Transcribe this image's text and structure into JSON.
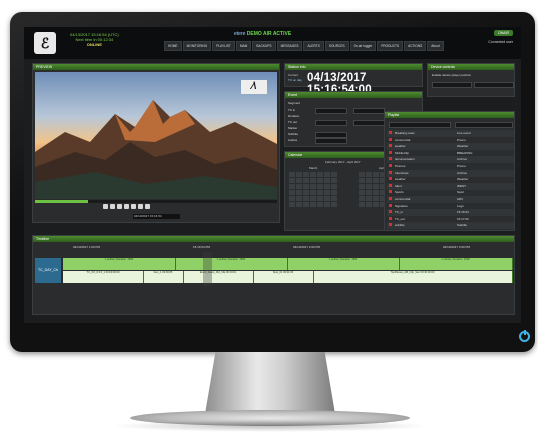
{
  "screen": {
    "header": {
      "clock_line1": "04/13/2017 15:16:54 (UTC)",
      "clock_line2": "Next item in 00:12:34",
      "clock_line3": "ONLINE",
      "app_title_prefix": "etere",
      "app_title_main": "DEMO AIR ACTIVE",
      "status_button": "ONAIR",
      "user": "Connected user"
    },
    "nav": [
      "HOME",
      "MONITORING",
      "PLAYLIST",
      "MAM",
      "BACKUPS",
      "MESSAGES",
      "ALERTS",
      "SOURCES",
      "On-air logger",
      "PRODUCTS",
      "ACTIONS",
      "About"
    ],
    "player": {
      "title": "PREVIEW",
      "timecode_box": "04/13/2017 15:16:54"
    },
    "clock_panel": {
      "title": "Station info",
      "label": "Current",
      "small": "TC on day",
      "timecode": "04/13/2017 15:16:54:00"
    },
    "props": {
      "title": "Event",
      "fields": [
        "Segment",
        "TC in",
        "Duration",
        "TC out",
        "Marker",
        "Subtitle",
        "Audios"
      ]
    },
    "calendar": {
      "title": "Calendar",
      "range": "February 2017 - April 2017",
      "month1": "March",
      "month2": "April"
    },
    "right_panel": {
      "title": "Device controls",
      "line": "Enable device player position"
    },
    "list": {
      "title": "Playlist",
      "rows": [
        [
          "Breaking news",
          "Live event"
        ],
        [
          "commercial",
          "Promo"
        ],
        [
          "weather",
          "Weather"
        ],
        [
          "MobileClip",
          "BREAKING"
        ],
        [
          "documentation",
          "Archive"
        ],
        [
          "Promos",
          "Promo"
        ],
        [
          "Interviews",
          "Archive"
        ],
        [
          "weather",
          "Weather"
        ],
        [
          "Ident",
          "IDENT"
        ],
        [
          "Sports",
          "Sport"
        ],
        [
          "commercial",
          "ADV"
        ],
        [
          "Signature",
          "Logo"
        ],
        [
          "TC_in",
          "15:16:54"
        ],
        [
          "TC_out",
          "15:17:00"
        ],
        [
          "subtitle",
          "Subtitle"
        ]
      ]
    },
    "small_panel": {
      "title": "Status view",
      "line1": "Next",
      "line2": "Slow"
    },
    "timeline": {
      "title": "Timeline",
      "channel": "TC_DAY_Ch",
      "times": [
        "04/13/2017 1:00 PM",
        "15:16:54 PM",
        "04/13/2017 2:00 PM",
        "04/13/2017 3:00 PM"
      ],
      "row1": [
        "1 entries, Duration: 1500",
        "1 entries, Duration: 1500",
        "1 entries, Duration: 1500",
        "1 entries, Duration: 1500"
      ],
      "row2": [
        "TC_0:0_0:0:0_1 00:00:00:00",
        "Item_1 00:00:05",
        "Event_News_AM_Clip 00:04:01",
        "Spot_01 00:01:00",
        "Top4News_AM_Clip_Sec 00:30:00:00"
      ]
    }
  }
}
